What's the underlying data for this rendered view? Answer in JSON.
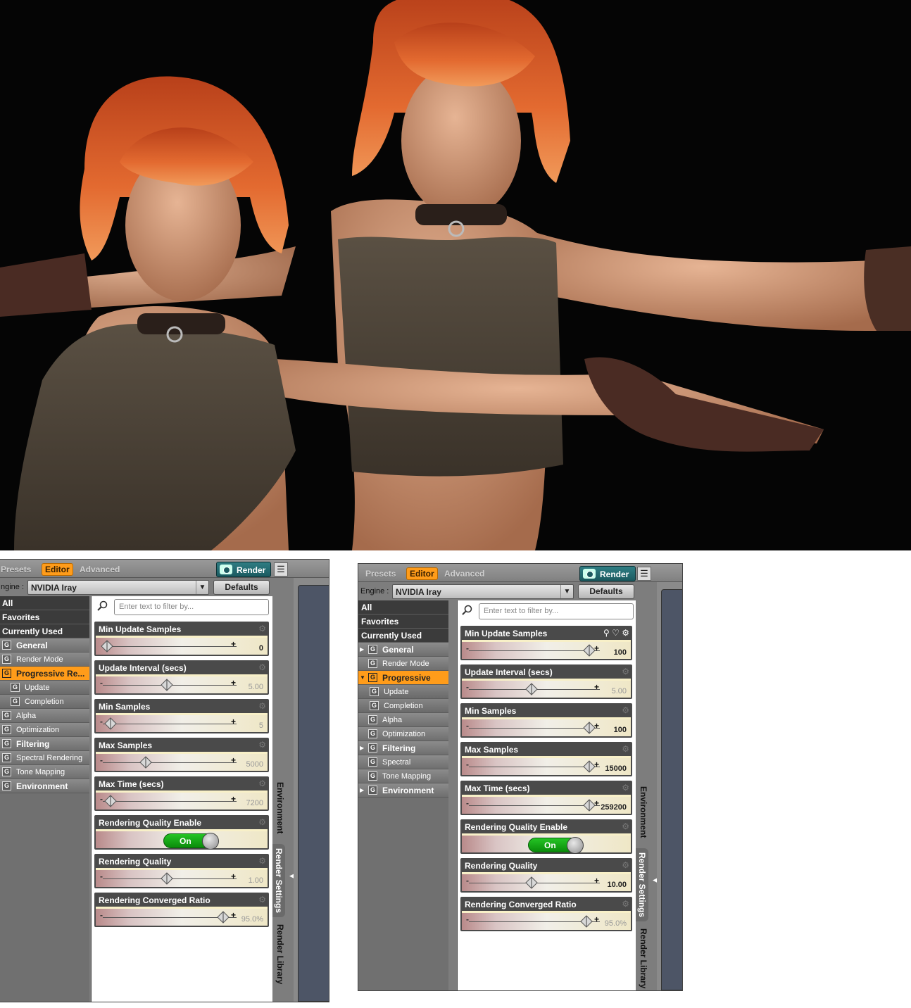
{
  "panel_left": {
    "tabs": [
      "Presets",
      "Editor",
      "Advanced"
    ],
    "render_button": "Render",
    "engine_label": "ngine :",
    "engine_value": "NVIDIA Iray",
    "defaults_button": "Defaults",
    "filter_placeholder": "Enter text to filter by...",
    "top_filters": [
      "All",
      "Favorites",
      "Currently Used"
    ],
    "categories": [
      {
        "label": "General",
        "level": 0,
        "selected": false,
        "bold": true
      },
      {
        "label": "Render Mode",
        "level": 0,
        "selected": false,
        "bold": false
      },
      {
        "label": "Progressive Re...",
        "level": 0,
        "selected": true,
        "bold": true
      },
      {
        "label": "Update",
        "level": 1,
        "selected": false,
        "bold": false
      },
      {
        "label": "Completion",
        "level": 1,
        "selected": false,
        "bold": false
      },
      {
        "label": "Alpha",
        "level": 0,
        "selected": false,
        "bold": false
      },
      {
        "label": "Optimization",
        "level": 0,
        "selected": false,
        "bold": false
      },
      {
        "label": "Filtering",
        "level": 0,
        "selected": false,
        "bold": true
      },
      {
        "label": "Spectral Rendering",
        "level": 0,
        "selected": false,
        "bold": false
      },
      {
        "label": "Tone Mapping",
        "level": 0,
        "selected": false,
        "bold": false
      },
      {
        "label": "Environment",
        "level": 0,
        "selected": false,
        "bold": true
      }
    ],
    "sliders": [
      {
        "title": "Min Update Samples",
        "value": "0",
        "pos": 0.02,
        "dim": false,
        "minus": false
      },
      {
        "title": "Update Interval (secs)",
        "value": "5.00",
        "pos": 0.5,
        "dim": true,
        "minus": true
      },
      {
        "title": "Min Samples",
        "value": "5",
        "pos": 0.05,
        "dim": true,
        "minus": true
      },
      {
        "title": "Max Samples",
        "value": "5000",
        "pos": 0.33,
        "dim": true,
        "minus": true
      },
      {
        "title": "Max Time (secs)",
        "value": "7200",
        "pos": 0.05,
        "dim": true,
        "minus": true
      },
      {
        "title": "Rendering Quality Enable",
        "toggle": "On"
      },
      {
        "title": "Rendering Quality",
        "value": "1.00",
        "pos": 0.5,
        "dim": true,
        "minus": true
      },
      {
        "title": "Rendering Converged Ratio",
        "value": "95.0%",
        "pos": 0.95,
        "dim": true,
        "minus": true
      }
    ],
    "side_tabs": [
      "Environment",
      "Render Settings",
      "Render Library"
    ]
  },
  "panel_right": {
    "tabs": [
      "Presets",
      "Editor",
      "Advanced"
    ],
    "render_button": "Render",
    "engine_label": "Engine :",
    "engine_value": "NVIDIA Iray",
    "defaults_button": "Defaults",
    "filter_placeholder": "Enter text to filter by...",
    "top_filters": [
      "All",
      "Favorites",
      "Currently Used"
    ],
    "categories": [
      {
        "label": "General",
        "level": 0,
        "selected": false,
        "bold": true,
        "expand": true
      },
      {
        "label": "Render Mode",
        "level": 0,
        "selected": false,
        "bold": false
      },
      {
        "label": "Progressive Re...",
        "level": 0,
        "selected": true,
        "bold": true,
        "expand": true
      },
      {
        "label": "Update",
        "level": 1,
        "selected": false,
        "bold": false
      },
      {
        "label": "Completion",
        "level": 1,
        "selected": false,
        "bold": false
      },
      {
        "label": "Alpha",
        "level": 0,
        "selected": false,
        "bold": false
      },
      {
        "label": "Optimization",
        "level": 0,
        "selected": false,
        "bold": false
      },
      {
        "label": "Filtering",
        "level": 0,
        "selected": false,
        "bold": true,
        "expand": true
      },
      {
        "label": "Spectral Rendering",
        "level": 0,
        "selected": false,
        "bold": false
      },
      {
        "label": "Tone Mapping",
        "level": 0,
        "selected": false,
        "bold": false
      },
      {
        "label": "Environment",
        "level": 0,
        "selected": false,
        "bold": true,
        "expand": true
      }
    ],
    "sliders": [
      {
        "title": "Min Update Samples",
        "value": "100",
        "pos": 0.97,
        "dim": false,
        "minus": true,
        "icons": true
      },
      {
        "title": "Update Interval (secs)",
        "value": "5.00",
        "pos": 0.5,
        "dim": true,
        "minus": true
      },
      {
        "title": "Min Samples",
        "value": "100",
        "pos": 0.97,
        "dim": false,
        "minus": true
      },
      {
        "title": "Max Samples",
        "value": "15000",
        "pos": 0.97,
        "dim": false,
        "minus": true
      },
      {
        "title": "Max Time (secs)",
        "value": "259200",
        "pos": 0.97,
        "dim": false,
        "minus": true
      },
      {
        "title": "Rendering Quality Enable",
        "toggle": "On"
      },
      {
        "title": "Rendering Quality",
        "value": "10.00",
        "pos": 0.5,
        "dim": false,
        "minus": true
      },
      {
        "title": "Rendering Converged Ratio",
        "value": "95.0%",
        "pos": 0.95,
        "dim": true,
        "minus": true
      }
    ],
    "side_tabs": [
      "Environment",
      "Render Settings",
      "Render Library"
    ]
  },
  "colors": {
    "accent": "#ff9c1a",
    "render_bg": "#050505",
    "toggle_on": "#17a817"
  }
}
